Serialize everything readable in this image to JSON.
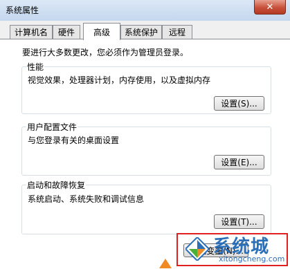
{
  "window": {
    "title": "系统属性",
    "close_symbol": "✕"
  },
  "tabs": [
    {
      "label": "计算机名",
      "active": false
    },
    {
      "label": "硬件",
      "active": false
    },
    {
      "label": "高级",
      "active": true
    },
    {
      "label": "系统保护",
      "active": false
    },
    {
      "label": "远程",
      "active": false
    }
  ],
  "admin_note": "要进行大多数更改，您必须作为管理员登录。",
  "groups": {
    "performance": {
      "legend": "性能",
      "description": "视觉效果，处理器计划，内存使用，以及虚拟内存",
      "button": "设置(S)..."
    },
    "user_profiles": {
      "legend": "用户配置文件",
      "description": "与您登录有关的桌面设置",
      "button": "设置(E)..."
    },
    "startup_recovery": {
      "legend": "启动和故障恢复",
      "description": "系统启动、系统失败和调试信息",
      "button": "设置(T)..."
    }
  },
  "env_button": "环境变量(N)...",
  "watermark": {
    "text": "系统城",
    "url": "xitongcheng.com"
  },
  "colors": {
    "close_red": "#c8503a",
    "highlight_red": "#e02020",
    "watermark_blue": "#2a6fb8",
    "watermark_green": "#4caf3a"
  }
}
